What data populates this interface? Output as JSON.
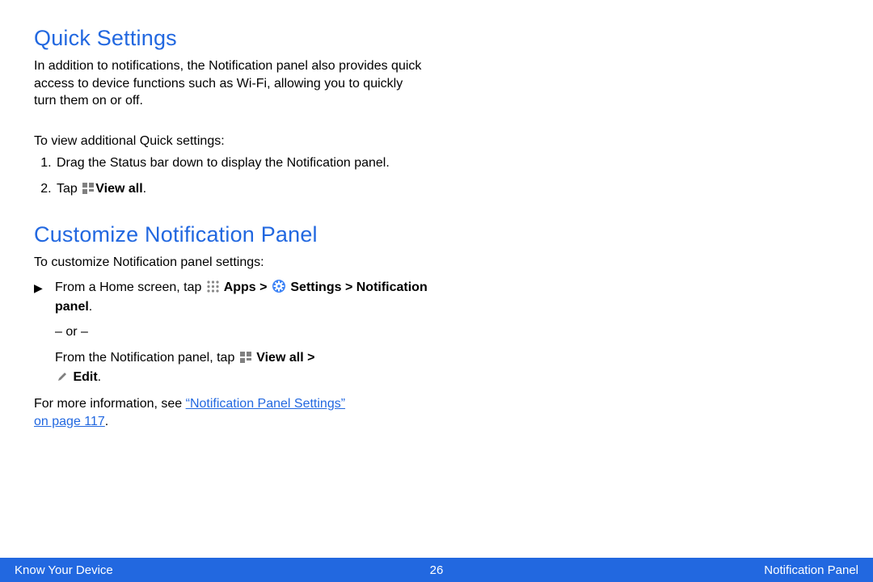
{
  "section1": {
    "heading": "Quick Settings",
    "intro": "In addition to notifications, the Notification panel also provides quick access to device functions such as Wi-Fi, allowing you to quickly turn them on or off.",
    "lead": "To view additional Quick settings:",
    "step1": "Drag the Status bar down to display the Notification panel.",
    "step2_prefix": "Tap ",
    "step2_bold": "View all",
    "step2_suffix": "."
  },
  "section2": {
    "heading": "Customize Notification Panel",
    "lead": "To customize Notification panel settings:",
    "line1_a": "From a Home screen, tap ",
    "line1_apps": " Apps > ",
    "line1_settings": " Settings > Notification panel",
    "line1_suffix": ".",
    "or": "– or –",
    "line2_a": "From the Notification panel, tap ",
    "line2_viewall": " View all > ",
    "line2_edit": " Edit",
    "line2_suffix": ".",
    "more_prefix": "For more information, see ",
    "xref": "“Notification Panel Settings” on page 117",
    "more_suffix": "."
  },
  "footer": {
    "left": "Know Your Device",
    "center": "26",
    "right": "Notification Panel"
  }
}
